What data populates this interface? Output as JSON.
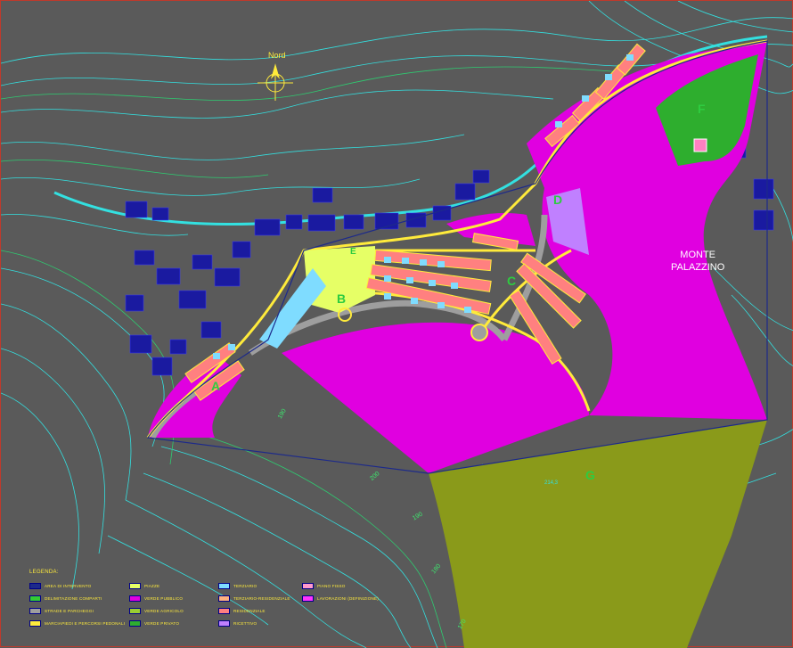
{
  "north_label": "Nord",
  "place_label": [
    "MONTE",
    "PALAZZINO"
  ],
  "zone_letters": [
    "A",
    "B",
    "C",
    "D",
    "E",
    "F",
    "G"
  ],
  "elevation_labels": [
    "200",
    "190",
    "180",
    "170",
    "190",
    "214,3"
  ],
  "legend": {
    "title": "LEGENDA:",
    "items": [
      {
        "label": "AREA DI INTERVENTO",
        "color": "#1d2a8a"
      },
      {
        "label": "DELIMITAZIONE COMPARTI",
        "color": "#33cc33"
      },
      {
        "label": "STRADE E PARCHEGGI",
        "color": "#9e9e9e"
      },
      {
        "label": "MARCIAPIEDI E PERCORSI PEDONALI",
        "color": "#ffeb3b"
      },
      {
        "label": "PIAZZE",
        "color": "#e6ff66"
      },
      {
        "label": "VERDE PUBBLICO",
        "color": "#e000e0"
      },
      {
        "label": "VERDE AGRICOLO",
        "color": "#9acd32"
      },
      {
        "label": "VERDE PRIVATO",
        "color": "#2eae2e"
      },
      {
        "label": "TERZIARIO",
        "color": "#7fdcff"
      },
      {
        "label": "TERZIARIO-RESIDENZIALE",
        "color": "#ffb27f"
      },
      {
        "label": "RESIDENZIALE",
        "color": "#ff8080"
      },
      {
        "label": "RICETTIVO",
        "color": "#c080ff"
      },
      {
        "label": "PIANO FISSO",
        "color": "#ff99cc"
      },
      {
        "label": "LAVORAZIONI (DEFINIZIONE)",
        "color": "#ff33ff"
      }
    ]
  },
  "colors": {
    "background": "#5a5a5a",
    "contour": "#33e0e0",
    "contour_green": "#2ecc71",
    "public_green": "#e000e0",
    "agricultural_green": "#8a9a1a",
    "private_green": "#2eae2e",
    "road": "#9e9e9e",
    "walkway": "#ffeb3b",
    "existing_buildings": "#1a1aa0",
    "tertiary": "#7fdcff",
    "residential": "#ff8080",
    "receptive": "#c080ff"
  }
}
